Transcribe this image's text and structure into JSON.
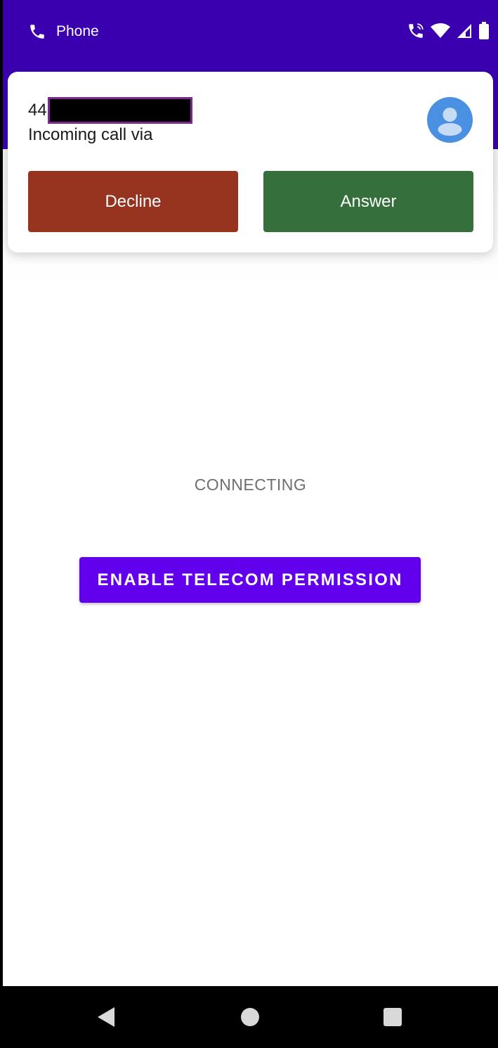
{
  "status_bar": {
    "app_name": "Phone",
    "icons": [
      "phone-icon",
      "wifi-calling-icon",
      "wifi-icon",
      "signal-icon",
      "battery-icon"
    ],
    "background_color": "#3a00b0"
  },
  "notification": {
    "caller_number_prefix": "44",
    "caller_number_redacted": true,
    "subtitle": "Incoming call via",
    "avatar_icon": "person-icon",
    "decline_label": "Decline",
    "answer_label": "Answer",
    "decline_color": "#963420",
    "answer_color": "#35703c"
  },
  "main": {
    "status_text": "CONNECTING",
    "permission_button_label": "ENABLE TELECOM PERMISSION",
    "accent_color": "#6200ee"
  },
  "nav_bar": {
    "items": [
      "back-icon",
      "home-icon",
      "recents-icon"
    ]
  }
}
